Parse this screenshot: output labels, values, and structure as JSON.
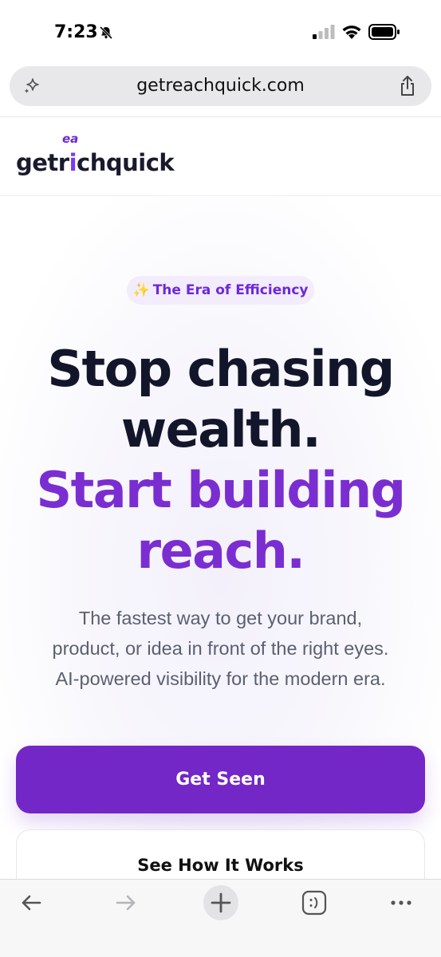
{
  "status_bar": {
    "time": "7:23"
  },
  "address_bar": {
    "url": "getreachquick.com"
  },
  "header": {
    "logo": {
      "part1": "getr",
      "part2": "i",
      "part3": "ch",
      "part4": "quick",
      "superscript": "ea"
    }
  },
  "hero": {
    "badge": "The Era of Efficiency",
    "badge_emoji": "✨",
    "headline_line1": "Stop chasing",
    "headline_line2": "wealth.",
    "headline_line3": "Start building",
    "headline_line4": "reach.",
    "subtext_line1": "The fastest way to get your brand,",
    "subtext_line2": "product, or idea in front of the right eyes.",
    "subtext_line3": "AI-powered visibility for the modern era.",
    "cta_primary": "Get Seen",
    "cta_secondary": "See How It Works"
  },
  "colors": {
    "accent": "#7327c6",
    "headline_dark": "#13162b",
    "headline_purple": "#7a2ed1",
    "badge_bg": "#f2ecfc"
  },
  "icons": {
    "status": [
      "bell-off-icon",
      "signal-icon",
      "wifi-icon",
      "battery-icon"
    ],
    "address": [
      "sparkle-icon",
      "share-icon"
    ],
    "toolbar": [
      "back-icon",
      "forward-icon",
      "plus-icon",
      "tabs-icon",
      "more-icon"
    ]
  }
}
